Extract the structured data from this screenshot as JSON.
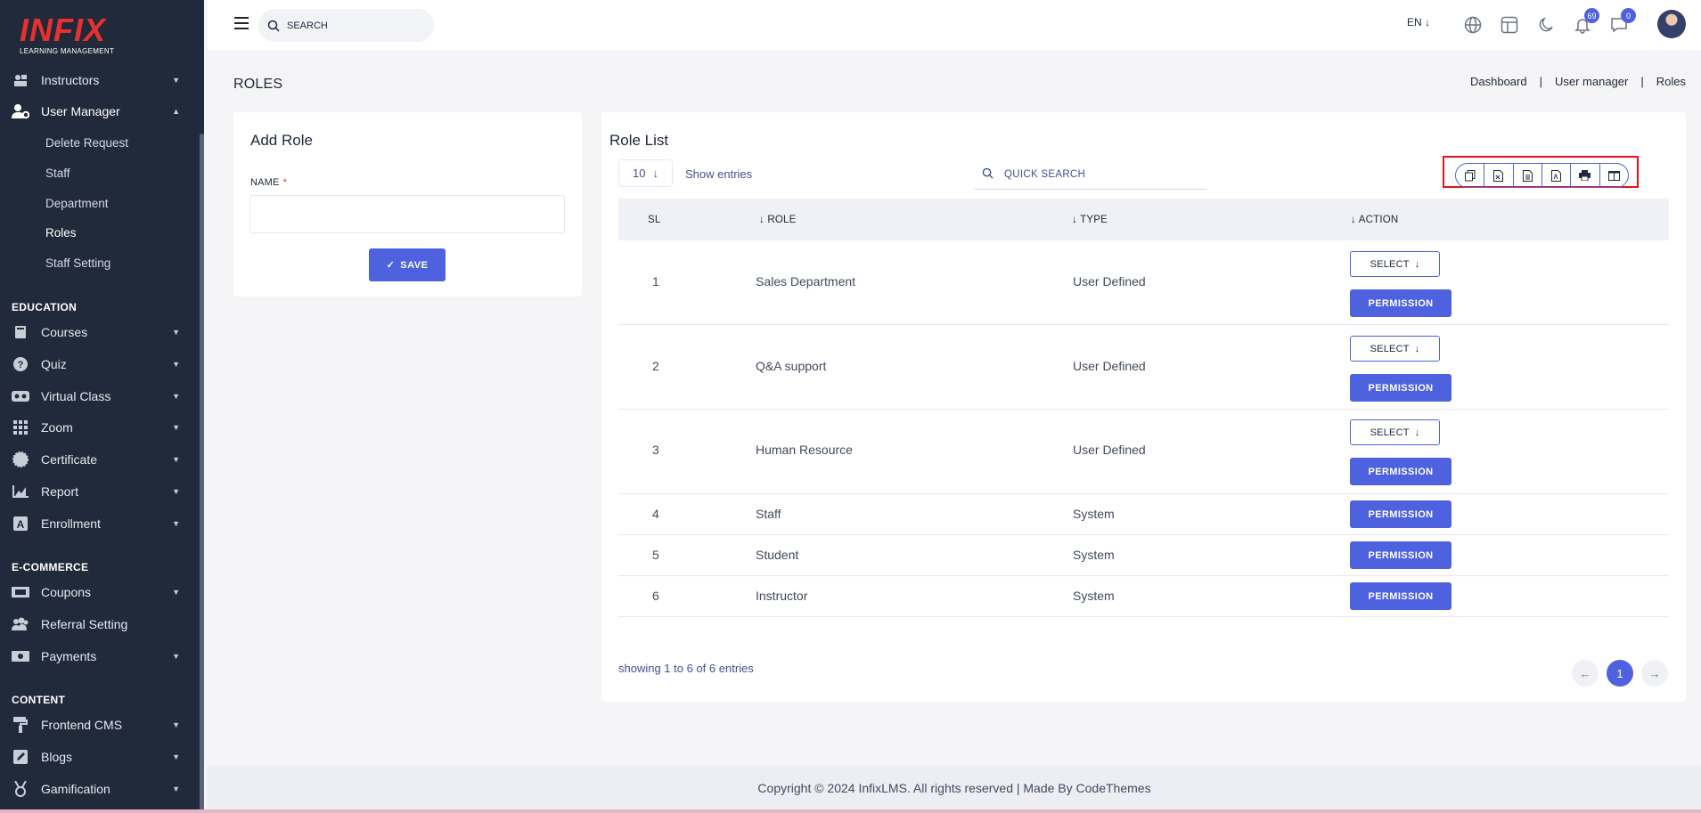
{
  "brand": {
    "logo_text": "INFIX",
    "logo_subtitle": "LEARNING MANAGEMENT"
  },
  "sidebar": {
    "items_top": [
      {
        "label": "Instructors",
        "icon": "instructor-icon"
      },
      {
        "label": "User Manager",
        "icon": "user-gear-icon"
      }
    ],
    "user_manager_sub": [
      "Delete Request",
      "Staff",
      "Department",
      "Roles",
      "Staff Setting"
    ],
    "sections": {
      "education": "EDUCATION",
      "ecommerce": "E-COMMERCE",
      "content": "CONTENT"
    },
    "education_items": [
      "Courses",
      "Quiz",
      "Virtual Class",
      "Zoom",
      "Certificate",
      "Report",
      "Enrollment"
    ],
    "ecommerce_items": [
      "Coupons",
      "Referral Setting",
      "Payments"
    ],
    "content_items": [
      "Frontend CMS",
      "Blogs",
      "Gamification"
    ]
  },
  "topbar": {
    "search_placeholder": "SEARCH",
    "language": "EN",
    "notifications_count": "69",
    "messages_count": "0"
  },
  "page": {
    "title": "ROLES",
    "breadcrumb": [
      "Dashboard",
      "User manager",
      "Roles"
    ]
  },
  "add_role": {
    "title": "Add Role",
    "name_label": "NAME",
    "required_mark": "*",
    "save_label": "SAVE"
  },
  "role_list": {
    "title": "Role List",
    "entries_value": "10",
    "show_entries_label": "Show entries",
    "quick_search_placeholder": "QUICK SEARCH",
    "columns": [
      "SL",
      "ROLE",
      "TYPE",
      "ACTION"
    ],
    "select_label": "SELECT",
    "permission_label": "PERMISSION",
    "rows": [
      {
        "sl": "1",
        "role": "Sales Department",
        "type": "User Defined"
      },
      {
        "sl": "2",
        "role": "Q&A support",
        "type": "User Defined"
      },
      {
        "sl": "3",
        "role": "Human Resource",
        "type": "User Defined"
      },
      {
        "sl": "4",
        "role": "Staff",
        "type": "System"
      },
      {
        "sl": "5",
        "role": "Student",
        "type": "System"
      },
      {
        "sl": "6",
        "role": "Instructor",
        "type": "System"
      }
    ],
    "showing_text": "showing 1 to 6 of 6 entries",
    "current_page": "1"
  },
  "footer": {
    "text": "Copyright © 2024 InfixLMS. All rights reserved | Made By CodeThemes"
  },
  "colors": {
    "accent": "#4e62e0",
    "sidebar_bg": "#202a3a",
    "highlight_box": "#e8101a"
  }
}
